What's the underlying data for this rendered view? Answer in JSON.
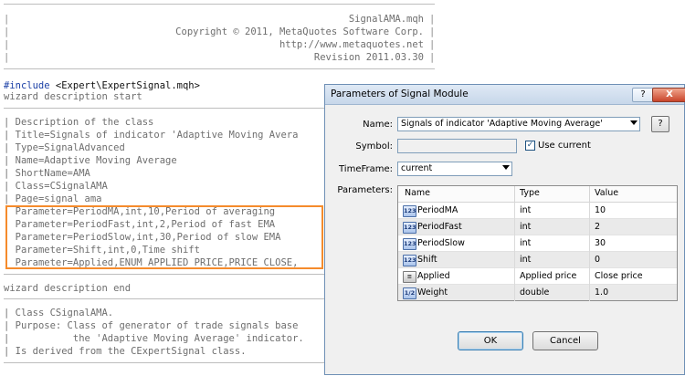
{
  "code": {
    "header_lines": [
      "SignalAMA.mqh",
      "Copyright © 2011, MetaQuotes Software Corp.",
      "http://www.metaquotes.net",
      "Revision 2011.03.30"
    ],
    "include_kw": "#include",
    "include_path": "<Expert\\ExpertSignal.mqh>",
    "wizard_start": "wizard description start",
    "desc_lines": [
      "Description of the class",
      "Title=Signals of indicator 'Adaptive Moving Avera",
      "Type=SignalAdvanced",
      "Name=Adaptive Moving Average",
      "ShortName=AMA",
      "Class=CSignalAMA",
      "Page=signal ama"
    ],
    "param_lines": [
      "Parameter=PeriodMA,int,10,Period of averaging",
      "Parameter=PeriodFast,int,2,Period of fast EMA",
      "Parameter=PeriodSlow,int,30,Period of slow EMA",
      "Parameter=Shift,int,0,Time shift",
      "Parameter=Applied,ENUM_APPLIED_PRICE,PRICE_CLOSE,"
    ],
    "wizard_end": "wizard description end",
    "class_lines": [
      "Class CSignalAMA.",
      "Purpose: Class of generator of trade signals base",
      "          the 'Adaptive Moving Average' indicator.",
      "Is derived from the CExpertSignal class."
    ]
  },
  "dialog": {
    "title": "Parameters of Signal Module",
    "help_btn": "?",
    "close_btn": "X",
    "name_label": "Name:",
    "name_value": "Signals of indicator 'Adaptive Moving Average'",
    "q_btn": "?",
    "symbol_label": "Symbol:",
    "use_current_label": "Use current",
    "use_current_checked": true,
    "timeframe_label": "TimeFrame:",
    "timeframe_value": "current",
    "parameters_label": "Parameters:",
    "columns": [
      "Name",
      "Type",
      "Value"
    ],
    "rows": [
      {
        "name": "PeriodMA",
        "type": "int",
        "value": "10",
        "icon": "123"
      },
      {
        "name": "PeriodFast",
        "type": "int",
        "value": "2",
        "icon": "123"
      },
      {
        "name": "PeriodSlow",
        "type": "int",
        "value": "30",
        "icon": "123"
      },
      {
        "name": "Shift",
        "type": "int",
        "value": "0",
        "icon": "123"
      },
      {
        "name": "Applied",
        "type": "Applied price",
        "value": "Close price",
        "icon": "enum"
      },
      {
        "name": "Weight",
        "type": "double",
        "value": "1.0",
        "icon": "1/2"
      }
    ],
    "ok": "OK",
    "cancel": "Cancel"
  },
  "colors": {
    "highlight": "#f58b2c",
    "keyword": "#1a3fa6"
  }
}
